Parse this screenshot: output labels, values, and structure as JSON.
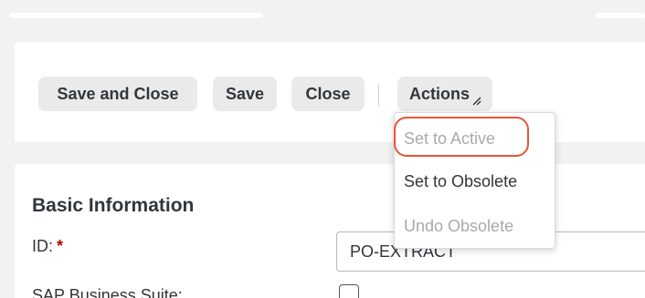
{
  "toolbar": {
    "save_and_close_label": "Save and Close",
    "save_label": "Save",
    "close_label": "Close",
    "actions_label": "Actions"
  },
  "actions_menu": {
    "items": [
      {
        "label": "Set to Active",
        "enabled": false,
        "highlighted": true
      },
      {
        "label": "Set to Obsolete",
        "enabled": true,
        "highlighted": false
      },
      {
        "label": "Undo Obsolete",
        "enabled": false,
        "highlighted": false
      }
    ]
  },
  "form": {
    "section_title": "Basic Information",
    "id_label": "ID:",
    "id_required_marker": "*",
    "id_value": "PO-EXTRACT",
    "suite_label": "SAP Business Suite:",
    "suite_checked": false
  },
  "colors": {
    "highlight_ring": "#e8553a",
    "required": "#bb0000",
    "button_bg": "#eaeaea",
    "disabled_text": "#a9a9a9"
  },
  "icons": {
    "actions_button": "resize-grip-icon"
  }
}
